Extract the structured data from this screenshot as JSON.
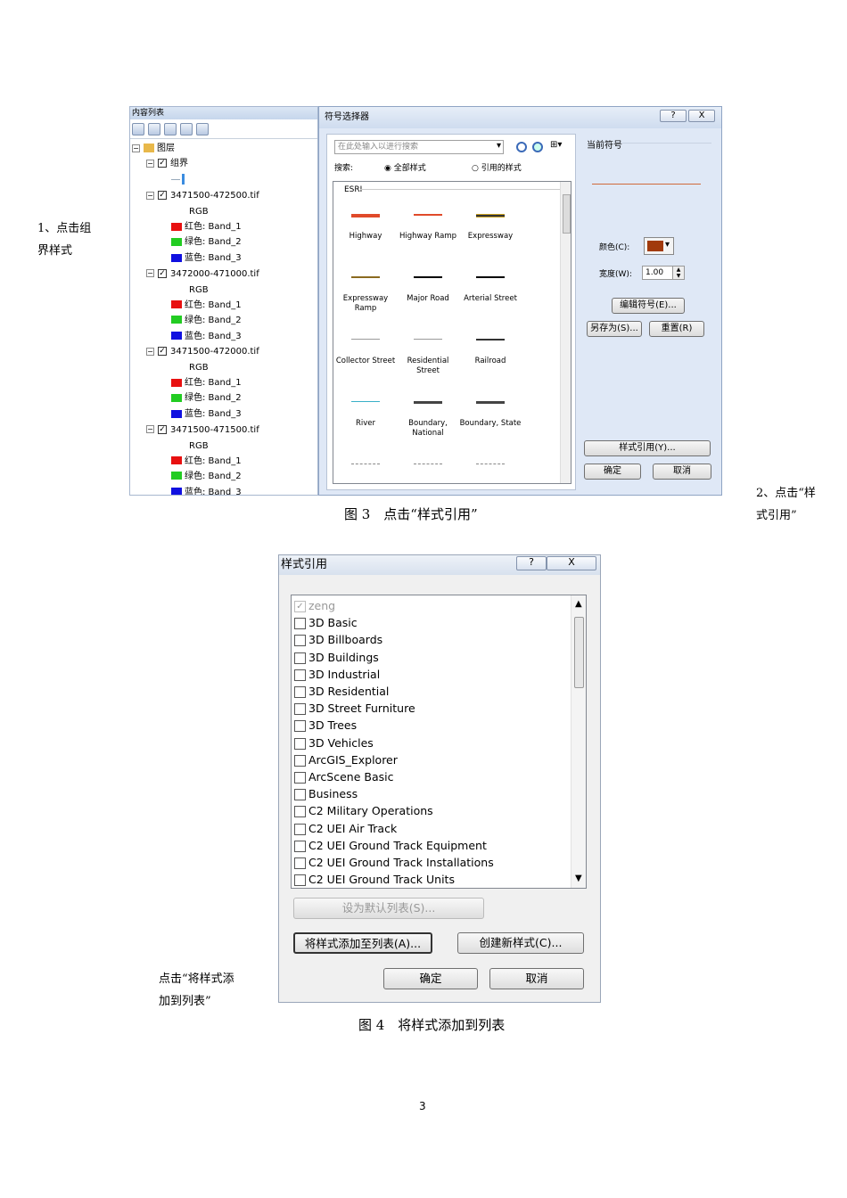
{
  "notes": {
    "note1_line1": "1、点击组",
    "note1_line2": "界样式",
    "note2_line1": "2、点击“样",
    "note2_line2": "式引用”",
    "note3_line1": "点击“将样式添",
    "note3_line2": "加到列表”"
  },
  "captions": {
    "fig3": "图 3　点击“样式引用”",
    "fig4": "图 4　将样式添加到列表"
  },
  "page_number": "3",
  "toc": {
    "title": "内容列表",
    "root": "图层",
    "group": "组界",
    "layers": [
      {
        "name": "3471500-472500.tif",
        "rgb": "RGB",
        "red": "红色:   Band_1",
        "green": "绿色: Band_2",
        "blue": "蓝色:   Band_3"
      },
      {
        "name": "3472000-471000.tif",
        "rgb": "RGB",
        "red": "红色:   Band_1",
        "green": "绿色: Band_2",
        "blue": "蓝色:   Band_3"
      },
      {
        "name": "3471500-472000.tif",
        "rgb": "RGB",
        "red": "红色:   Band_1",
        "green": "绿色: Band_2",
        "blue": "蓝色:   Band_3"
      },
      {
        "name": "3471500-471500.tif",
        "rgb": "RGB",
        "red": "红色:   Band_1",
        "green": "绿色: Band_2",
        "blue": "蓝色:   Band_3"
      }
    ],
    "colors": {
      "red": "#e81010",
      "green": "#22cc22",
      "blue": "#1010e0"
    }
  },
  "symbol_selector": {
    "title": "符号选择器",
    "help": "?",
    "close": "X",
    "search_placeholder": "在此处输入以进行搜索",
    "search_label": "搜索:",
    "radio_all": "全部样式",
    "radio_ref": "引用的样式",
    "group_label": "ESRI",
    "items": [
      {
        "label": "Highway",
        "color": "#e04a2a"
      },
      {
        "label": "Highway Ramp",
        "color": "#e04a2a"
      },
      {
        "label": "Expressway",
        "color": "#333"
      },
      {
        "label": "Expressway Ramp",
        "color": "#8a6a20"
      },
      {
        "label": "Major Road",
        "color": "#000"
      },
      {
        "label": "Arterial Street",
        "color": "#000"
      },
      {
        "label": "Collector Street",
        "color": "#555"
      },
      {
        "label": "Residential Street",
        "color": "#555"
      },
      {
        "label": "Railroad",
        "color": "#333"
      },
      {
        "label": "River",
        "color": "#3ab0c8"
      },
      {
        "label": "Boundary, National",
        "color": "#444"
      },
      {
        "label": "Boundary, State",
        "color": "#444"
      }
    ],
    "current_symbol": "当前符号",
    "color_label": "颜色(C):",
    "width_label": "宽度(W):",
    "width_value": "1.00",
    "current_color": "#a13a0c",
    "edit_btn": "编辑符号(E)...",
    "save_btn": "另存为(S)...",
    "reset_btn": "重置(R)",
    "style_ref_btn": "样式引用(Y)...",
    "ok_btn": "确定",
    "cancel_btn": "取消"
  },
  "style_refs": {
    "title": "样式引用",
    "help": "?",
    "close": "X",
    "items": [
      {
        "label": "zeng",
        "checked": true,
        "disabled": true
      },
      {
        "label": "3D Basic"
      },
      {
        "label": "3D Billboards"
      },
      {
        "label": "3D Buildings"
      },
      {
        "label": "3D Industrial"
      },
      {
        "label": "3D Residential"
      },
      {
        "label": "3D Street Furniture"
      },
      {
        "label": "3D Trees"
      },
      {
        "label": "3D Vehicles"
      },
      {
        "label": "ArcGIS_Explorer"
      },
      {
        "label": "ArcScene Basic"
      },
      {
        "label": "Business"
      },
      {
        "label": "C2 Military Operations"
      },
      {
        "label": "C2 UEI Air Track"
      },
      {
        "label": "C2 UEI Ground Track Equipment"
      },
      {
        "label": "C2 UEI Ground Track Installations"
      },
      {
        "label": "C2 UEI Ground Track Units"
      }
    ],
    "default_btn": "设为默认列表(S)...",
    "add_btn": "将样式添加至列表(A)...",
    "create_btn": "创建新样式(C)...",
    "ok_btn": "确定",
    "cancel_btn": "取消"
  }
}
